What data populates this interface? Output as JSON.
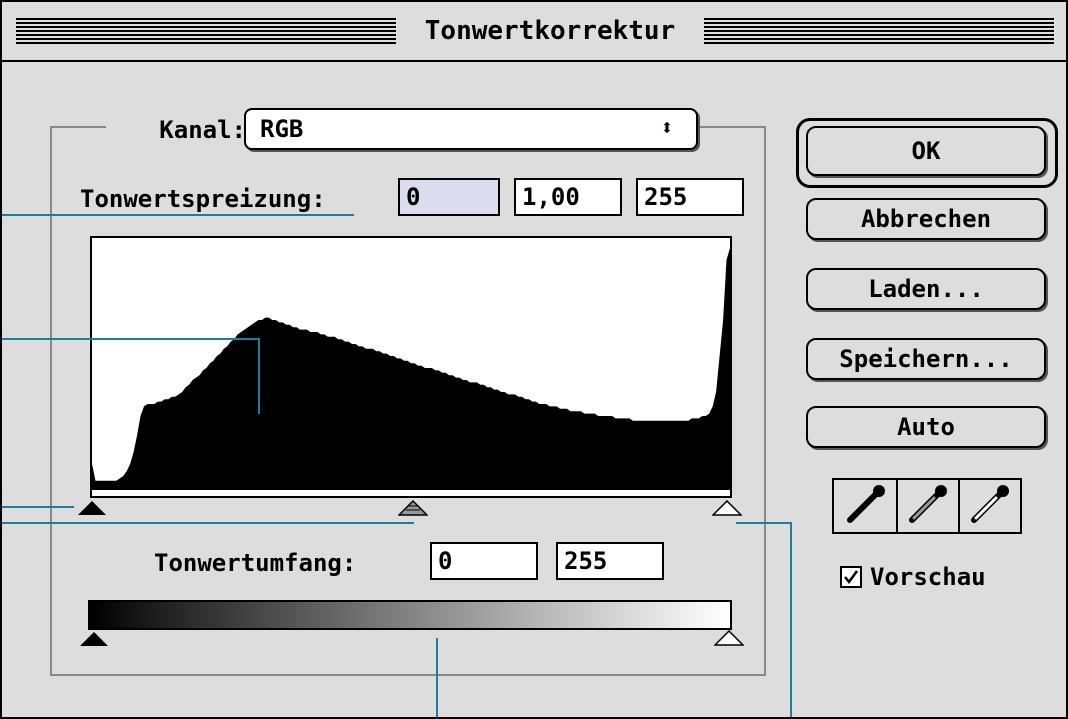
{
  "window": {
    "title": "Tonwertkorrektur"
  },
  "channel": {
    "label": "Kanal:",
    "value": "RGB"
  },
  "input_levels": {
    "label": "Tonwertspreizung:",
    "black": "0",
    "gamma": "1,00",
    "white": "255"
  },
  "output_levels": {
    "label": "Tonwertumfang:",
    "black": "0",
    "white": "255"
  },
  "buttons": {
    "ok": "OK",
    "cancel": "Abbrechen",
    "load": "Laden...",
    "save": "Speichern...",
    "auto": "Auto"
  },
  "preview": {
    "label": "Vorschau",
    "checked": true
  },
  "colors": {
    "dialog_bg": "#dddddd",
    "active_field": "#dcdcee",
    "callout_line": "#1a7f9c"
  },
  "histogram": {
    "levels": [
      10,
      3,
      3,
      3,
      3,
      3,
      3,
      3,
      4,
      5,
      7,
      10,
      15,
      22,
      30,
      34,
      35,
      35,
      35,
      36,
      36,
      37,
      37,
      38,
      38,
      39,
      40,
      42,
      43,
      45,
      46,
      47,
      49,
      50,
      52,
      53,
      55,
      56,
      58,
      59,
      61,
      62,
      64,
      65,
      66,
      67,
      68,
      69,
      70,
      70,
      71,
      71,
      70,
      70,
      69,
      69,
      68,
      68,
      67,
      67,
      66,
      66,
      66,
      65,
      65,
      65,
      64,
      64,
      63,
      63,
      63,
      62,
      62,
      61,
      61,
      60,
      60,
      59,
      59,
      58,
      58,
      58,
      57,
      57,
      56,
      56,
      55,
      55,
      54,
      54,
      53,
      53,
      52,
      52,
      51,
      51,
      50,
      50,
      50,
      49,
      49,
      48,
      48,
      47,
      47,
      46,
      46,
      45,
      45,
      44,
      44,
      44,
      43,
      43,
      42,
      42,
      41,
      41,
      40,
      40,
      39,
      39,
      39,
      38,
      38,
      37,
      37,
      36,
      36,
      35,
      35,
      35,
      34,
      34,
      34,
      33,
      33,
      33,
      32,
      32,
      32,
      32,
      31,
      31,
      31,
      31,
      30,
      30,
      30,
      30,
      30,
      29,
      29,
      29,
      29,
      29,
      28,
      28,
      28,
      28,
      28,
      28,
      28,
      28,
      28,
      28,
      28,
      28,
      28,
      28,
      28,
      28,
      28,
      29,
      29,
      29,
      30,
      30,
      31,
      34,
      40,
      55,
      70,
      95,
      100
    ]
  }
}
